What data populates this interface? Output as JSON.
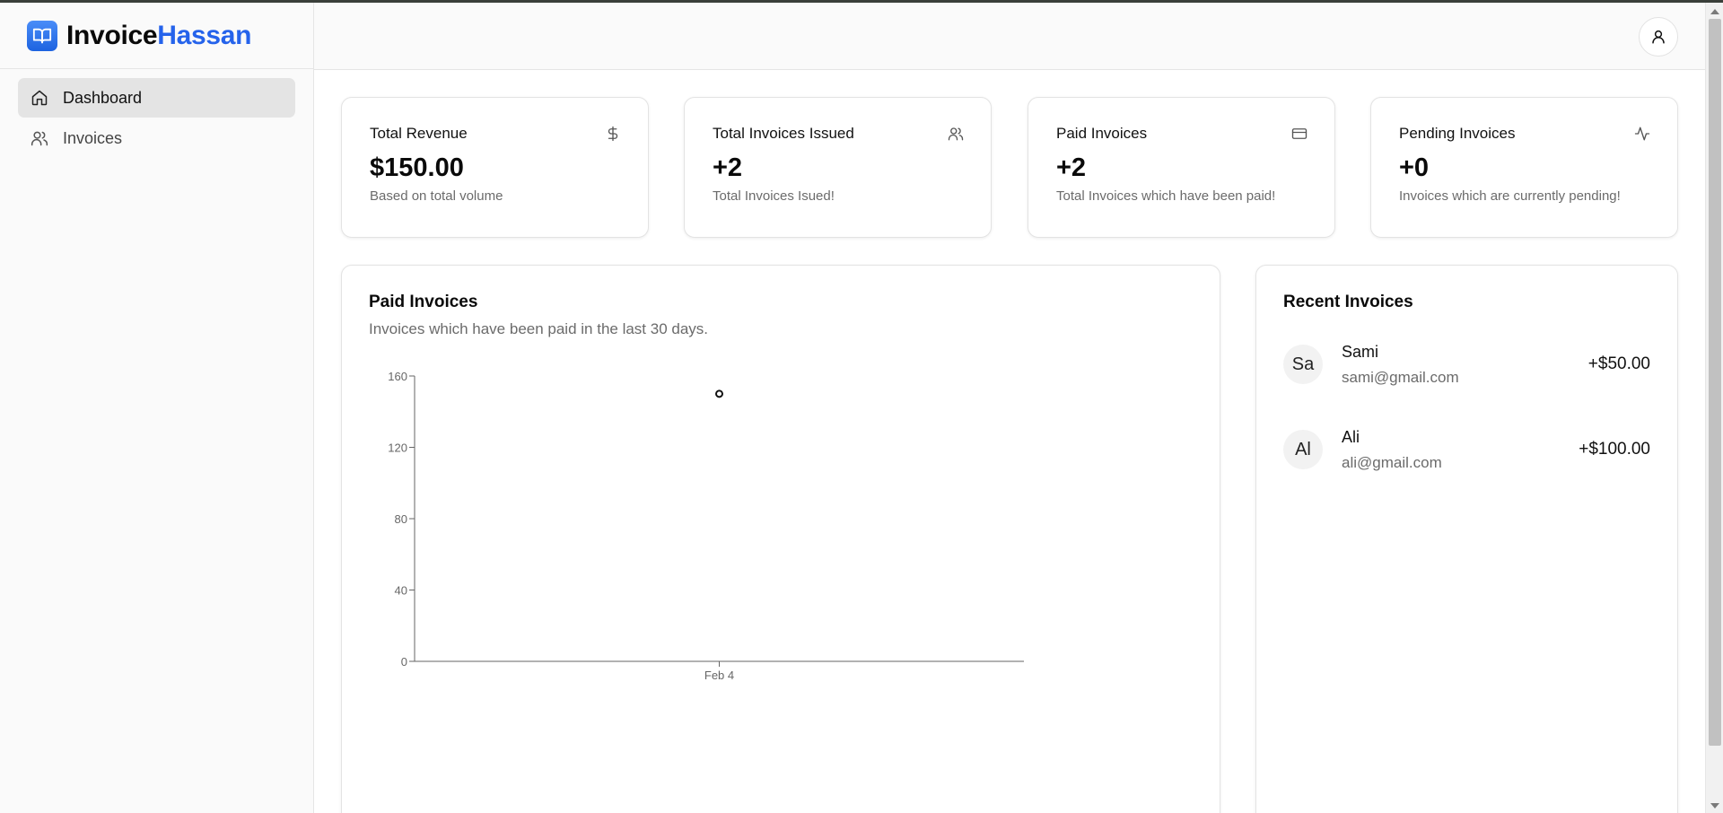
{
  "brand": {
    "part1": "Invoice",
    "part2": "Hassan",
    "accent_color": "#2563eb",
    "icon": "book-open-icon"
  },
  "sidebar": {
    "items": [
      {
        "label": "Dashboard",
        "icon": "home-icon",
        "active": true
      },
      {
        "label": "Invoices",
        "icon": "users-icon",
        "active": false
      }
    ]
  },
  "header": {
    "user_icon": "user-icon"
  },
  "stats": [
    {
      "title": "Total Revenue",
      "value": "$150.00",
      "desc": "Based on total volume",
      "icon": "dollar-icon"
    },
    {
      "title": "Total Invoices Issued",
      "value": "+2",
      "desc": "Total Invoices Isued!",
      "icon": "users-icon"
    },
    {
      "title": "Paid Invoices",
      "value": "+2",
      "desc": "Total Invoices which have been paid!",
      "icon": "credit-card-icon"
    },
    {
      "title": "Pending Invoices",
      "value": "+0",
      "desc": "Invoices which are currently pending!",
      "icon": "activity-icon"
    }
  ],
  "chart_card": {
    "title": "Paid Invoices",
    "subtitle": "Invoices which have been paid in the last 30 days."
  },
  "chart_data": {
    "type": "line",
    "x": [
      "Feb 4"
    ],
    "series": [
      {
        "values": [
          150
        ]
      }
    ],
    "ylim": [
      0,
      160
    ],
    "yticks": [
      0,
      40,
      80,
      120,
      160
    ],
    "grid": false
  },
  "recent": {
    "title": "Recent Invoices",
    "items": [
      {
        "initials": "Sa",
        "name": "Sami",
        "email": "sami@gmail.com",
        "amount": "+$50.00"
      },
      {
        "initials": "Al",
        "name": "Ali",
        "email": "ali@gmail.com",
        "amount": "+$100.00"
      }
    ]
  }
}
